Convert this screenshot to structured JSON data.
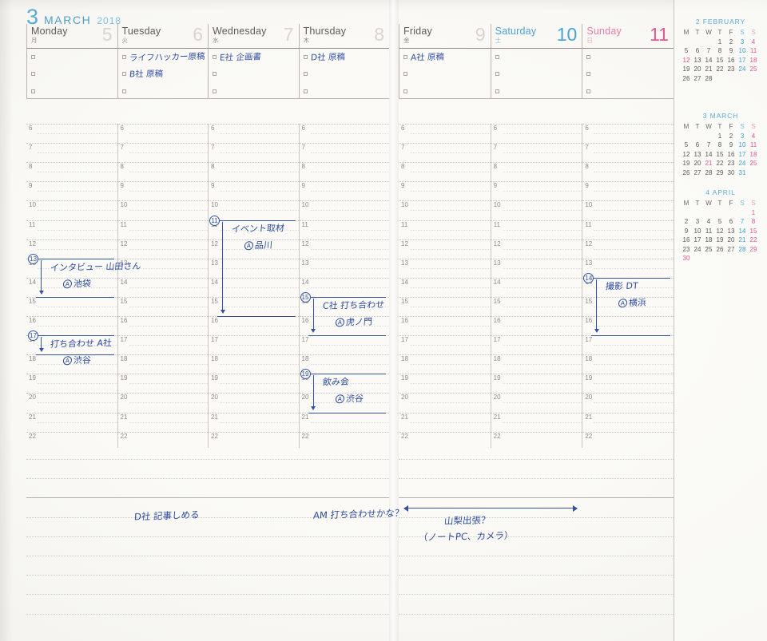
{
  "month_header": {
    "number": "3",
    "name": "MARCH",
    "year": "2018"
  },
  "colors": {
    "accent_blue": "#5aa9d6",
    "saturday": "#3f9fd4",
    "sunday": "#e3588f",
    "ink": "#2b4a9c",
    "paper": "#f4f3ef"
  },
  "days": [
    {
      "name": "Monday",
      "jp": "月",
      "num": "5",
      "kind": "weekday",
      "todos": [
        "",
        "",
        ""
      ],
      "events": [
        {
          "start": 13,
          "end": 15,
          "hour_label": "13",
          "title": "インタビュー 山田さん",
          "mark": "A",
          "location": "池袋"
        },
        {
          "start": 17,
          "end": 18,
          "hour_label": "17",
          "title": "打ち合わせ A社",
          "mark": "A",
          "location": "渋谷"
        }
      ]
    },
    {
      "name": "Tuesday",
      "jp": "火",
      "num": "6",
      "kind": "weekday",
      "todos": [
        "ライフハッカー原稿",
        "B社 原稿",
        ""
      ],
      "events": []
    },
    {
      "name": "Wednesday",
      "jp": "水",
      "num": "7",
      "kind": "weekday",
      "todos": [
        "E社 企画書",
        "",
        ""
      ],
      "events": [
        {
          "start": 11,
          "end": 16,
          "hour_label": "11",
          "title": "イベント取材",
          "mark": "A",
          "location": "品川"
        }
      ]
    },
    {
      "name": "Thursday",
      "jp": "木",
      "num": "8",
      "kind": "weekday",
      "todos": [
        "D社 原稿",
        "",
        ""
      ],
      "events": [
        {
          "start": 15,
          "end": 17,
          "hour_label": "15",
          "title": "C社 打ち合わせ",
          "mark": "A",
          "location": "虎ノ門"
        },
        {
          "start": 19,
          "end": 21,
          "hour_label": "19",
          "title": "飲み会",
          "mark": "A",
          "location": "渋谷"
        }
      ]
    },
    {
      "name": "Friday",
      "jp": "金",
      "num": "9",
      "kind": "weekday",
      "todos": [
        "A社 原稿",
        "",
        ""
      ],
      "events": []
    },
    {
      "name": "Saturday",
      "jp": "土",
      "num": "10",
      "kind": "saturday",
      "todos": [
        "",
        "",
        ""
      ],
      "events": []
    },
    {
      "name": "Sunday",
      "jp": "日",
      "num": "11",
      "kind": "sunday",
      "todos": [
        "",
        "",
        ""
      ],
      "events": [
        {
          "start": 14,
          "end": 17,
          "hour_label": "14",
          "title": "撮影 DT",
          "mark": "A",
          "location": "横浜"
        }
      ]
    }
  ],
  "time_scale": {
    "start": 6,
    "end": 22,
    "labels": [
      "6",
      "7",
      "8",
      "9",
      "10",
      "11",
      "12",
      "13",
      "14",
      "15",
      "16",
      "17",
      "18",
      "19",
      "20",
      "21",
      "22"
    ]
  },
  "bottom_notes": [
    {
      "text": "D社 記事しめる"
    },
    {
      "text": "AM 打ち合わせかな？"
    },
    {
      "text": "山梨出張？"
    },
    {
      "text": "（ノートPC、カメラ）"
    }
  ],
  "mini_calendars": [
    {
      "num": "2",
      "name": "FEBRUARY",
      "dow": [
        "M",
        "T",
        "W",
        "T",
        "F",
        "S",
        "S"
      ],
      "lead_blank": 3,
      "days": 28,
      "holidays": [
        12
      ]
    },
    {
      "num": "3",
      "name": "MARCH",
      "dow": [
        "M",
        "T",
        "W",
        "T",
        "F",
        "S",
        "S"
      ],
      "lead_blank": 3,
      "days": 31,
      "holidays": [
        21
      ]
    },
    {
      "num": "4",
      "name": "APRIL",
      "dow": [
        "M",
        "T",
        "W",
        "T",
        "F",
        "S",
        "S"
      ],
      "lead_blank": 6,
      "days": 30,
      "holidays": [
        30
      ]
    }
  ]
}
